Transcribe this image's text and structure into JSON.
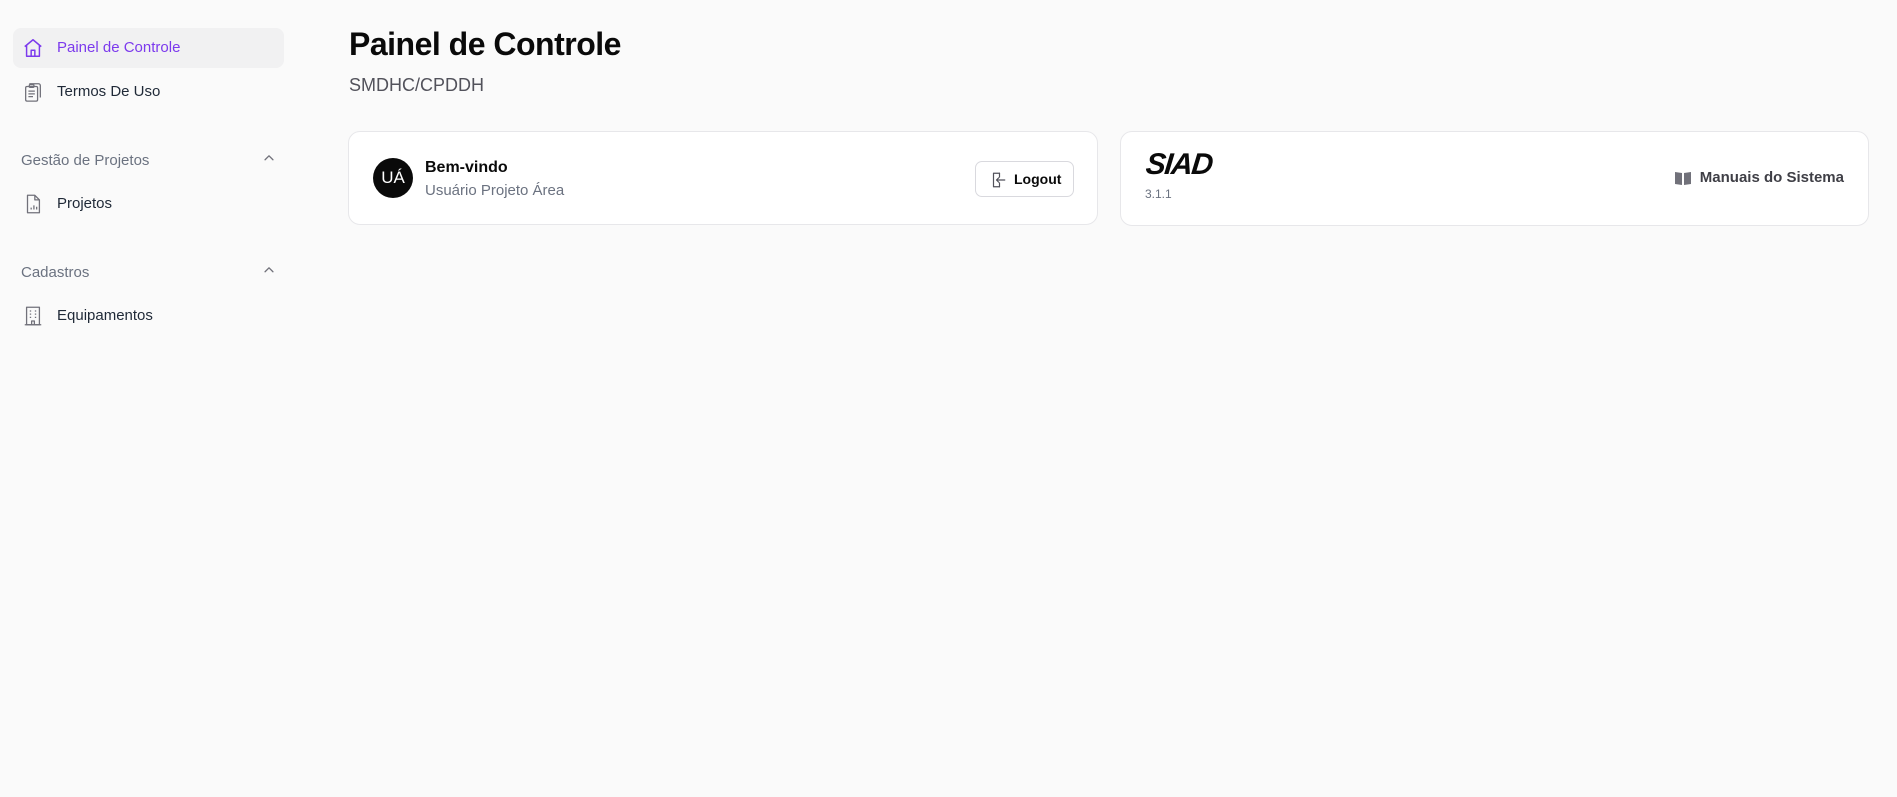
{
  "sidebar": {
    "items": [
      {
        "label": "Painel de Controle",
        "icon": "home-icon",
        "active": true
      },
      {
        "label": "Termos De Uso",
        "icon": "clipboard-icon",
        "active": false
      }
    ],
    "sections": [
      {
        "title": "Gestão de Projetos",
        "expanded": true,
        "items": [
          {
            "label": "Projetos",
            "icon": "file-chart-icon"
          }
        ]
      },
      {
        "title": "Cadastros",
        "expanded": true,
        "items": [
          {
            "label": "Equipamentos",
            "icon": "building-icon"
          }
        ]
      }
    ]
  },
  "header": {
    "title": "Painel de Controle",
    "subtitle": "SMDHC/CPDDH"
  },
  "welcome_card": {
    "avatar_initials": "UÁ",
    "greeting": "Bem-vindo",
    "user_name": "Usuário Projeto Área",
    "logout_label": "Logout"
  },
  "system_card": {
    "logo_text": "SIAD",
    "version": "3.1.1",
    "manuals_label": "Manuais do Sistema"
  },
  "colors": {
    "accent": "#7c3aed",
    "background": "#fafafa",
    "active_item_bg": "#f1f1f2"
  }
}
